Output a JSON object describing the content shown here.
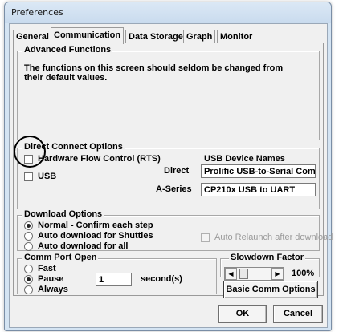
{
  "window": {
    "title": "Preferences"
  },
  "tabs": [
    {
      "label": "General",
      "active": false
    },
    {
      "label": "Communication",
      "active": true
    },
    {
      "label": "Data Storage",
      "active": false
    },
    {
      "label": "Graph",
      "active": false
    },
    {
      "label": "Monitor",
      "active": false
    }
  ],
  "advanced": {
    "legend": "Advanced Functions",
    "description": "The functions on this screen should seldom be changed from their default values."
  },
  "direct_connect": {
    "legend": "Direct Connect Options",
    "hardware_flow_label": "Hardware Flow Control (RTS)",
    "hardware_flow_checked": false,
    "usb_label": "USB",
    "usb_checked": false,
    "usb_device_names_label": "USB Device Names",
    "direct_label": "Direct",
    "direct_value": "Prolific USB-to-Serial Comm Port",
    "aseries_label": "A-Series",
    "aseries_value": "CP210x USB to UART"
  },
  "download": {
    "legend": "Download Options",
    "options": [
      {
        "label": "Normal - Confirm each step",
        "selected": true
      },
      {
        "label": "Auto download for Shuttles",
        "selected": false
      },
      {
        "label": "Auto download for all",
        "selected": false
      }
    ],
    "auto_relaunch_label": "Auto Relaunch after download",
    "auto_relaunch_enabled": false
  },
  "comm_port": {
    "legend": "Comm Port Open",
    "options": [
      {
        "label": "Fast",
        "selected": false
      },
      {
        "label": "Pause",
        "selected": true
      },
      {
        "label": "Always",
        "selected": false
      }
    ],
    "pause_seconds": "1",
    "seconds_label": "second(s)"
  },
  "slowdown": {
    "legend": "Slowdown Factor",
    "value_label": "100%",
    "level": 0.1
  },
  "buttons": {
    "basic_comm": "Basic Comm Options",
    "ok": "OK",
    "cancel": "Cancel"
  },
  "annotation": {
    "color": "#000000"
  }
}
